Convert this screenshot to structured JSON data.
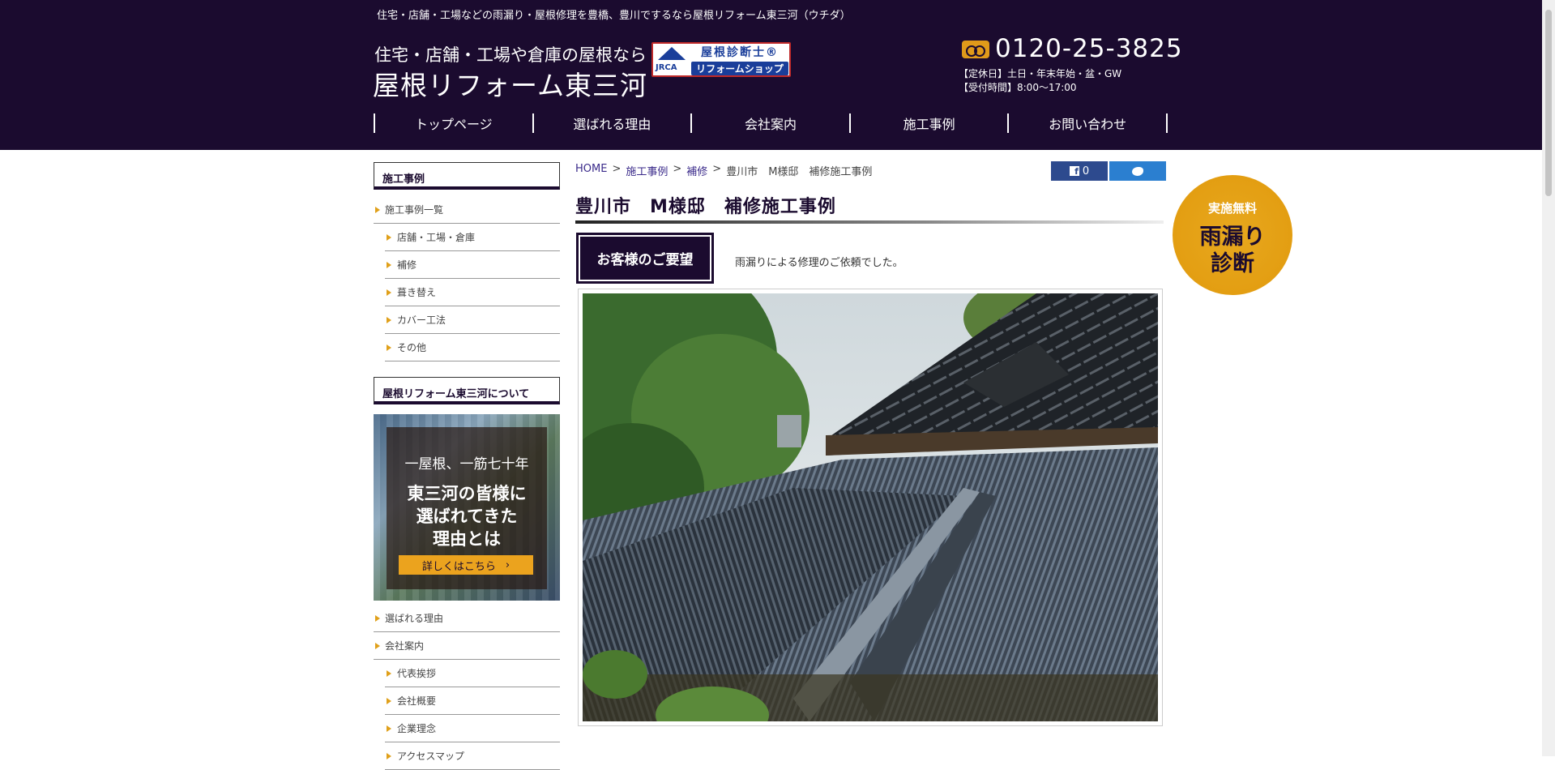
{
  "header": {
    "tagline": "住宅・店舗・工場などの雨漏り・屋根修理を豊橋、豊川でするなら屋根リフォーム東三河（ウチダ）",
    "brand_sub": "住宅・店舗・工場や倉庫の屋根なら",
    "brand_main": "屋根リフォーム東三河",
    "badge": {
      "mark": "JRCA",
      "line1": "屋根診断士®",
      "line2": "リフォームショップ"
    },
    "phone_icon": "free-dial-icon",
    "phone": "0120-25-3825",
    "closed_days": "【定休日】土日・年末年始・盆・GW",
    "hours": "【受付時間】8:00〜17:00"
  },
  "nav": [
    "トップページ",
    "選ばれる理由",
    "会社案内",
    "施工事例",
    "お問い合わせ"
  ],
  "sidebar": {
    "section1_title": "施工事例",
    "works": [
      {
        "label": "施工事例一覧",
        "level": 1
      },
      {
        "label": "店舗・工場・倉庫",
        "level": 2
      },
      {
        "label": "補修",
        "level": 2
      },
      {
        "label": "葺き替え",
        "level": 2
      },
      {
        "label": "カバー工法",
        "level": 2
      },
      {
        "label": "その他",
        "level": 2
      }
    ],
    "section2_title": "屋根リフォーム東三河について",
    "banner": {
      "line1": "一屋根、一筋七十年",
      "line2": "東三河の皆様に",
      "line3": "選ばれてきた",
      "line4": "理由とは",
      "button": "詳しくはこちら"
    },
    "about": [
      {
        "label": "選ばれる理由",
        "level": 1
      },
      {
        "label": "会社案内",
        "level": 1
      },
      {
        "label": "代表挨拶",
        "level": 2
      },
      {
        "label": "会社概要",
        "level": 2
      },
      {
        "label": "企業理念",
        "level": 2
      },
      {
        "label": "アクセスマップ",
        "level": 2
      }
    ]
  },
  "breadcrumb": {
    "home": "HOME",
    "sep": ">",
    "works": "施工事例",
    "category": "補修",
    "current": "豊川市　M様邸　補修施工事例"
  },
  "share": {
    "facebook_count": "0",
    "facebook_icon": "facebook-icon",
    "twitter_icon": "twitter-icon"
  },
  "main": {
    "title": "豊川市　M様邸　補修施工事例",
    "request_label": "お客様のご要望",
    "request_text": "雨漏りによる修理のご依頼でした。"
  },
  "free_badge": {
    "line1": "実施無料",
    "line2": "雨漏り",
    "line3": "診断"
  },
  "colors": {
    "navy": "#1b0b2f",
    "accent": "#e39e12",
    "link": "#3a2a8a"
  }
}
